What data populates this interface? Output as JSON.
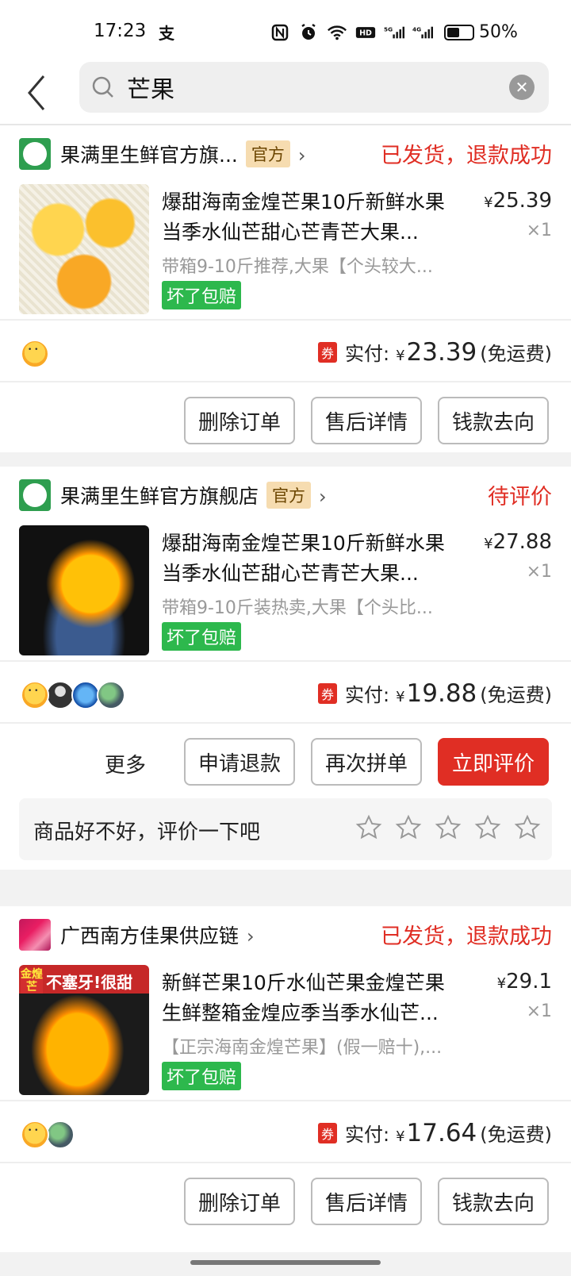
{
  "status_bar": {
    "time": "17:23",
    "alipay": "支",
    "battery": "50%",
    "battery_level": 0.5
  },
  "search": {
    "query": "芒果"
  },
  "orders": [
    {
      "shop": "果满里生鲜官方旗...",
      "shop_badge": "官方",
      "status": "已发货，退款成功",
      "title": "爆甜海南金煌芒果10斤新鲜水果当季水仙芒甜心芒青芒大果...",
      "spec": "带箱9-10斤推荐,大果【个头较大...",
      "tag": "坏了包赔",
      "price": "25.39",
      "price_symbol": "¥",
      "qty": "×1",
      "coupon": "券",
      "paid_label": "实付:",
      "paid_symbol": "¥",
      "paid": "23.39",
      "shipping": "(免运费)",
      "buttons": [
        "删除订单",
        "售后详情",
        "钱款去向"
      ]
    },
    {
      "shop": "果满里生鲜官方旗舰店",
      "shop_badge": "官方",
      "status": "待评价",
      "title": "爆甜海南金煌芒果10斤新鲜水果当季水仙芒甜心芒青芒大果...",
      "spec": "带箱9-10斤装热卖,大果【个头比...",
      "tag": "坏了包赔",
      "price": "27.88",
      "price_symbol": "¥",
      "qty": "×1",
      "coupon": "券",
      "paid_label": "实付:",
      "paid_symbol": "¥",
      "paid": "19.88",
      "shipping": "(免运费)",
      "more": "更多",
      "buttons": [
        "申请退款",
        "再次拼单",
        "立即评价"
      ],
      "rate_prompt": "商品好不好，评价一下吧",
      "rating_stars": 5
    },
    {
      "shop": "广西南方佳果供应链",
      "status": "已发货，退款成功",
      "title": "新鲜芒果10斤水仙芒果金煌芒果生鲜整箱金煌应季当季水仙芒...",
      "spec": "【正宗海南金煌芒果】(假一赔十),...",
      "image_text_1": "金煌芒",
      "image_text_2": "不塞牙!很甜",
      "tag": "坏了包赔",
      "price": "29.1",
      "price_symbol": "¥",
      "qty": "×1",
      "coupon": "券",
      "paid_label": "实付:",
      "paid_symbol": "¥",
      "paid": "17.64",
      "shipping": "(免运费)",
      "buttons": [
        "删除订单",
        "售后详情",
        "钱款去向"
      ]
    }
  ],
  "colors": {
    "accent_red": "#e02e24",
    "tag_green": "#2db84d",
    "official_bg": "#f6dcb0"
  }
}
